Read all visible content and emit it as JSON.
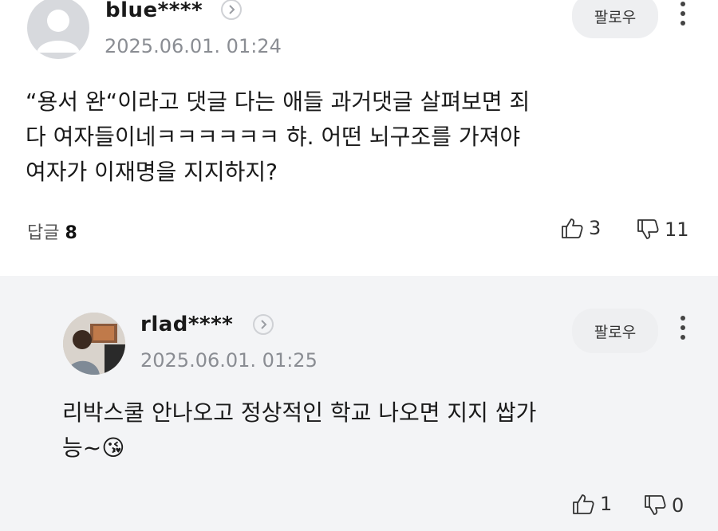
{
  "comments": [
    {
      "username": "blue****",
      "timestamp": "2025.06.01. 01:24",
      "follow_label": "팔로우",
      "text_lines": [
        "“용서 완“이라고 댓글 다는 애들 과거댓글 살펴보면 죄",
        "다 여자들이네ㅋㅋㅋㅋㅋㅋ 햐. 어떤 뇌구조를 가져야",
        "여자가 이재명을 지지하지?"
      ],
      "reply_label": "답글",
      "reply_count": "8",
      "likes": "3",
      "dislikes": "11",
      "avatar": "default-avatar-icon"
    },
    {
      "username": "rlad****",
      "timestamp": "2025.06.01. 01:25",
      "follow_label": "팔로우",
      "text_lines": [
        "리박스쿨 안나오고 정상적인 학교 나오면 지지 쌉가",
        "능~😘"
      ],
      "likes": "1",
      "dislikes": "0",
      "avatar": "photo-avatar"
    }
  ],
  "colors": {
    "reply_background": "#f3f4f6",
    "timestamp": "#8a8d93",
    "follow_button": "#eeeff1"
  }
}
